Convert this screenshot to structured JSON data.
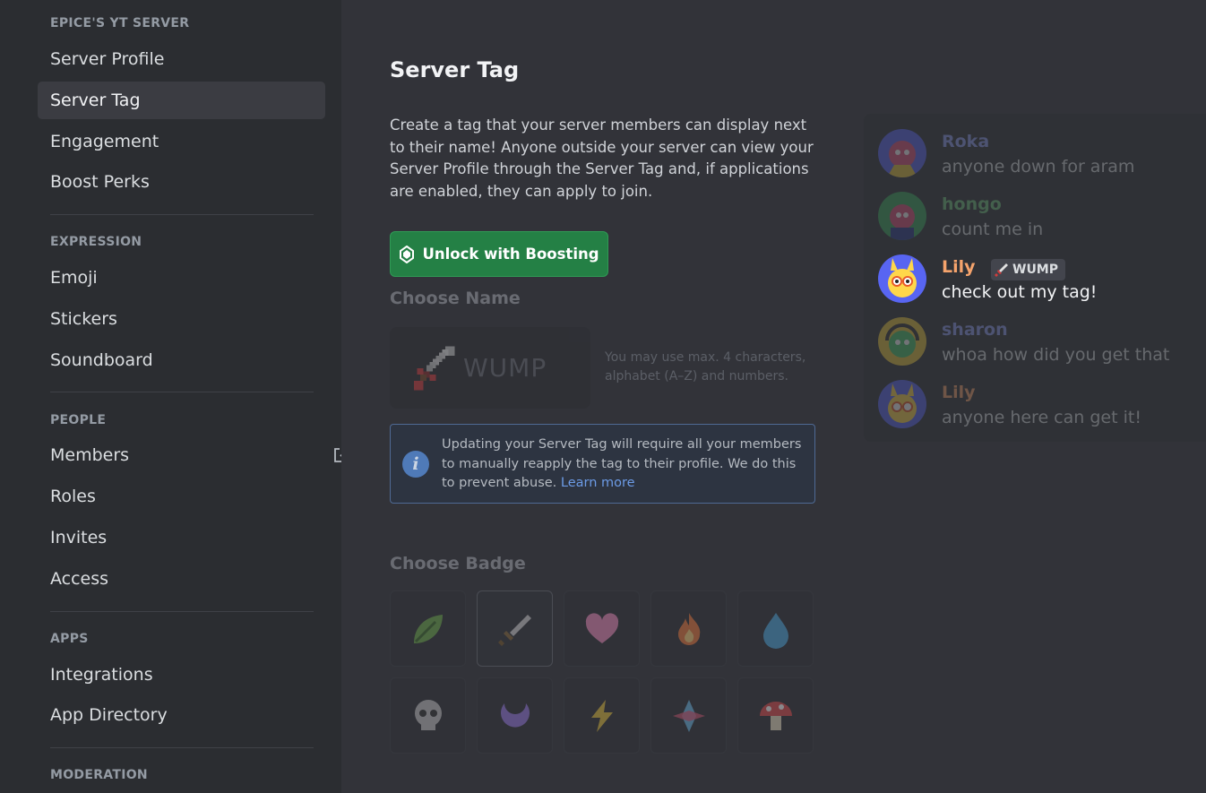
{
  "sidebar": {
    "sections": [
      {
        "header": "EPICE'S YT SERVER",
        "items": [
          "Server Profile",
          "Server Tag",
          "Engagement",
          "Boost Perks"
        ]
      },
      {
        "header": "EXPRESSION",
        "items": [
          "Emoji",
          "Stickers",
          "Soundboard"
        ]
      },
      {
        "header": "PEOPLE",
        "items": [
          "Members",
          "Roles",
          "Invites",
          "Access"
        ]
      },
      {
        "header": "APPS",
        "items": [
          "Integrations",
          "App Directory"
        ]
      },
      {
        "header": "MODERATION",
        "items": []
      }
    ],
    "active_item": "Server Tag",
    "members_link_icon": "external-link-icon"
  },
  "main": {
    "title": "Server Tag",
    "description": "Create a tag that your server members can display next to their name! Anyone outside your server can view your Server Profile through the Server Tag and, if applications are enabled, they can apply to join.",
    "boost_button": {
      "label": "Unlock with Boosting",
      "icon": "boost-gem-icon",
      "color": "#248045"
    },
    "choose_name": {
      "label": "Choose Name",
      "tag_text": "WUMP",
      "hint": "You may use max. 4 characters, alphabet (A–Z) and numbers."
    },
    "info_notice": {
      "text": "Updating your Server Tag will require all your members to manually reapply the tag to their profile. We do this to prevent abuse.",
      "link": "Learn more"
    },
    "choose_badge": {
      "label": "Choose Badge",
      "badges": [
        "leaf-icon",
        "sword-icon",
        "heart-icon",
        "fire-icon",
        "water-drop-icon",
        "skull-icon",
        "moon-icon",
        "lightning-icon",
        "crystal-icon",
        "mushroom-icon"
      ],
      "selected": "sword-icon"
    }
  },
  "chat_preview": {
    "messages": [
      {
        "name": "Roka",
        "text": "anyone down for aram",
        "name_color": "#8e9cf0"
      },
      {
        "name": "hongo",
        "text": "count me in",
        "name_color": "#6fbf7a"
      },
      {
        "name": "Lily",
        "text": "check out my tag!",
        "name_color": "#f5a36c",
        "tag": "WUMP"
      },
      {
        "name": "sharon",
        "text": "whoa how did you get that",
        "name_color": "#8e9cf0"
      },
      {
        "name": "Lily",
        "text": "anyone here can get it!",
        "name_color": "#f5a36c"
      }
    ]
  }
}
